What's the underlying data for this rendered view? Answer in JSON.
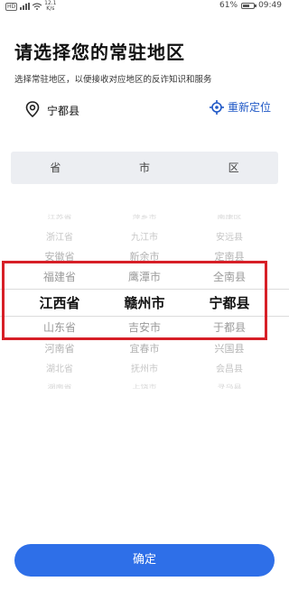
{
  "status_bar": {
    "network_badge": "HD",
    "speed_value": "12.1",
    "speed_unit": "K/s",
    "battery_percent": "61%",
    "battery_level": 0.61,
    "time": "09:49"
  },
  "header": {
    "title": "请选择您的常驻地区",
    "subtitle": "选择常驻地区，以便接收对应地区的反诈知识和服务"
  },
  "location": {
    "current": "宁都县",
    "relocate_label": "重新定位",
    "pin_icon": "location-pin-icon",
    "relocate_icon": "locate-target-icon"
  },
  "picker": {
    "headers": [
      "省",
      "市",
      "区"
    ],
    "columns": [
      [
        "江苏省",
        "浙江省",
        "安徽省",
        "福建省",
        "江西省",
        "山东省",
        "河南省",
        "湖北省",
        "湖南省"
      ],
      [
        "萍乡市",
        "九江市",
        "新余市",
        "鹰潭市",
        "赣州市",
        "吉安市",
        "宜春市",
        "抚州市",
        "上饶市"
      ],
      [
        "南康区",
        "安远县",
        "定南县",
        "全南县",
        "宁都县",
        "于都县",
        "兴国县",
        "会昌县",
        "寻乌县"
      ]
    ],
    "selected_index": 4,
    "accent_color": "#d71f27"
  },
  "confirm_label": "确定",
  "colors": {
    "primary": "#2e6fe8",
    "link": "#1f58c6",
    "highlight": "#d71f27"
  }
}
